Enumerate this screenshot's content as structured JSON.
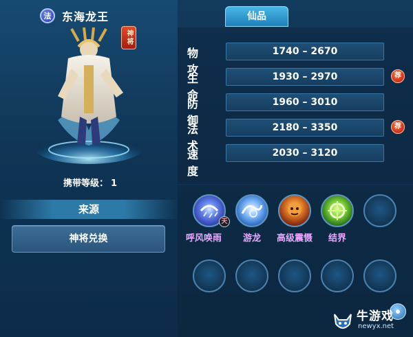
{
  "hero": {
    "class_badge": "法",
    "name": "东海龙王",
    "seal_text": "神将",
    "carry_level_label": "携带等级：",
    "carry_level_value": "1",
    "portrait_icon": "dragon-king-portrait"
  },
  "source": {
    "title": "来源",
    "exchange_button": "神将兑换"
  },
  "tab": {
    "label": "仙品"
  },
  "stats": [
    {
      "label": "物攻",
      "value": "1740 – 2670",
      "recommended": false
    },
    {
      "label": "生命",
      "value": "1930 – 2970",
      "recommended": true
    },
    {
      "label": "防御",
      "value": "1960 – 3010",
      "recommended": false
    },
    {
      "label": "法术",
      "value": "2180 – 3350",
      "recommended": true
    },
    {
      "label": "速度",
      "value": "2030 – 3120",
      "recommended": false
    }
  ],
  "recommend_badge": "荐",
  "skills": [
    {
      "name": "呼风唤雨",
      "icon": "wind-rain-icon",
      "tag": "天"
    },
    {
      "name": "游龙",
      "icon": "dragon-icon",
      "tag": ""
    },
    {
      "name": "高级震慑",
      "icon": "deter-icon",
      "tag": ""
    },
    {
      "name": "结界",
      "icon": "barrier-icon",
      "tag": ""
    }
  ],
  "empty_skill_slots": 6,
  "watermark": {
    "title": "牛游戏",
    "url": "newyx.net"
  },
  "colors": {
    "skill_name": "#e9a7ff",
    "tab_active": "#1f7fb8",
    "recommend": "#b11a0d"
  }
}
